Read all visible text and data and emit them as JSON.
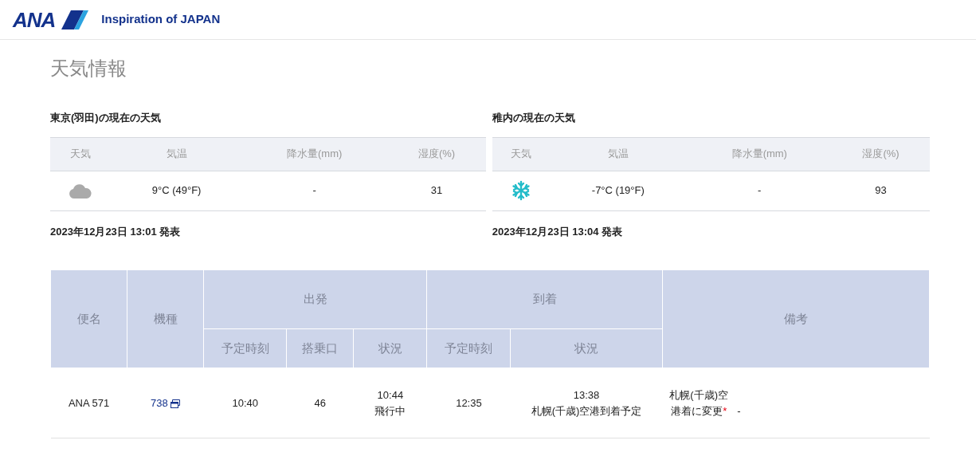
{
  "header": {
    "logo": "ANA",
    "tagline": "Inspiration of JAPAN"
  },
  "page_title": "天気情報",
  "weather": [
    {
      "title": "東京(羽田)の現在の天気",
      "columns": [
        "天気",
        "気温",
        "降水量(mm)",
        "湿度(%)"
      ],
      "condition": {
        "kind": "cloudy"
      },
      "temperature": "9°C (49°F)",
      "precipitation": "-",
      "humidity": "31",
      "issued": "2023年12月23日 13:01 発表"
    },
    {
      "title": "稚内の現在の天気",
      "columns": [
        "天気",
        "気温",
        "降水量(mm)",
        "湿度(%)"
      ],
      "condition": {
        "kind": "snow"
      },
      "temperature": "-7°C (19°F)",
      "precipitation": "-",
      "humidity": "93",
      "issued": "2023年12月23日 13:04 発表"
    }
  ],
  "flights": {
    "columns": {
      "flight": "便名",
      "aircraft": "機種",
      "departure": "出発",
      "arrival": "到着",
      "remarks": "備考",
      "dep_sub": [
        "予定時刻",
        "搭乗口",
        "状況"
      ],
      "arr_sub": [
        "予定時刻",
        "状況"
      ]
    },
    "rows": [
      {
        "flight": "ANA 571",
        "aircraft": "738",
        "dep_scheduled": "10:40",
        "gate": "46",
        "dep_time": "10:44",
        "dep_status": "飛行中",
        "arr_scheduled": "12:35",
        "arr_time": "13:38",
        "arr_status": "札幌(千歳)空港到着予定",
        "remark": "札幌(千歳)空港着に変更",
        "remark_mark": "*",
        "remark_extra": "-"
      }
    ]
  }
}
